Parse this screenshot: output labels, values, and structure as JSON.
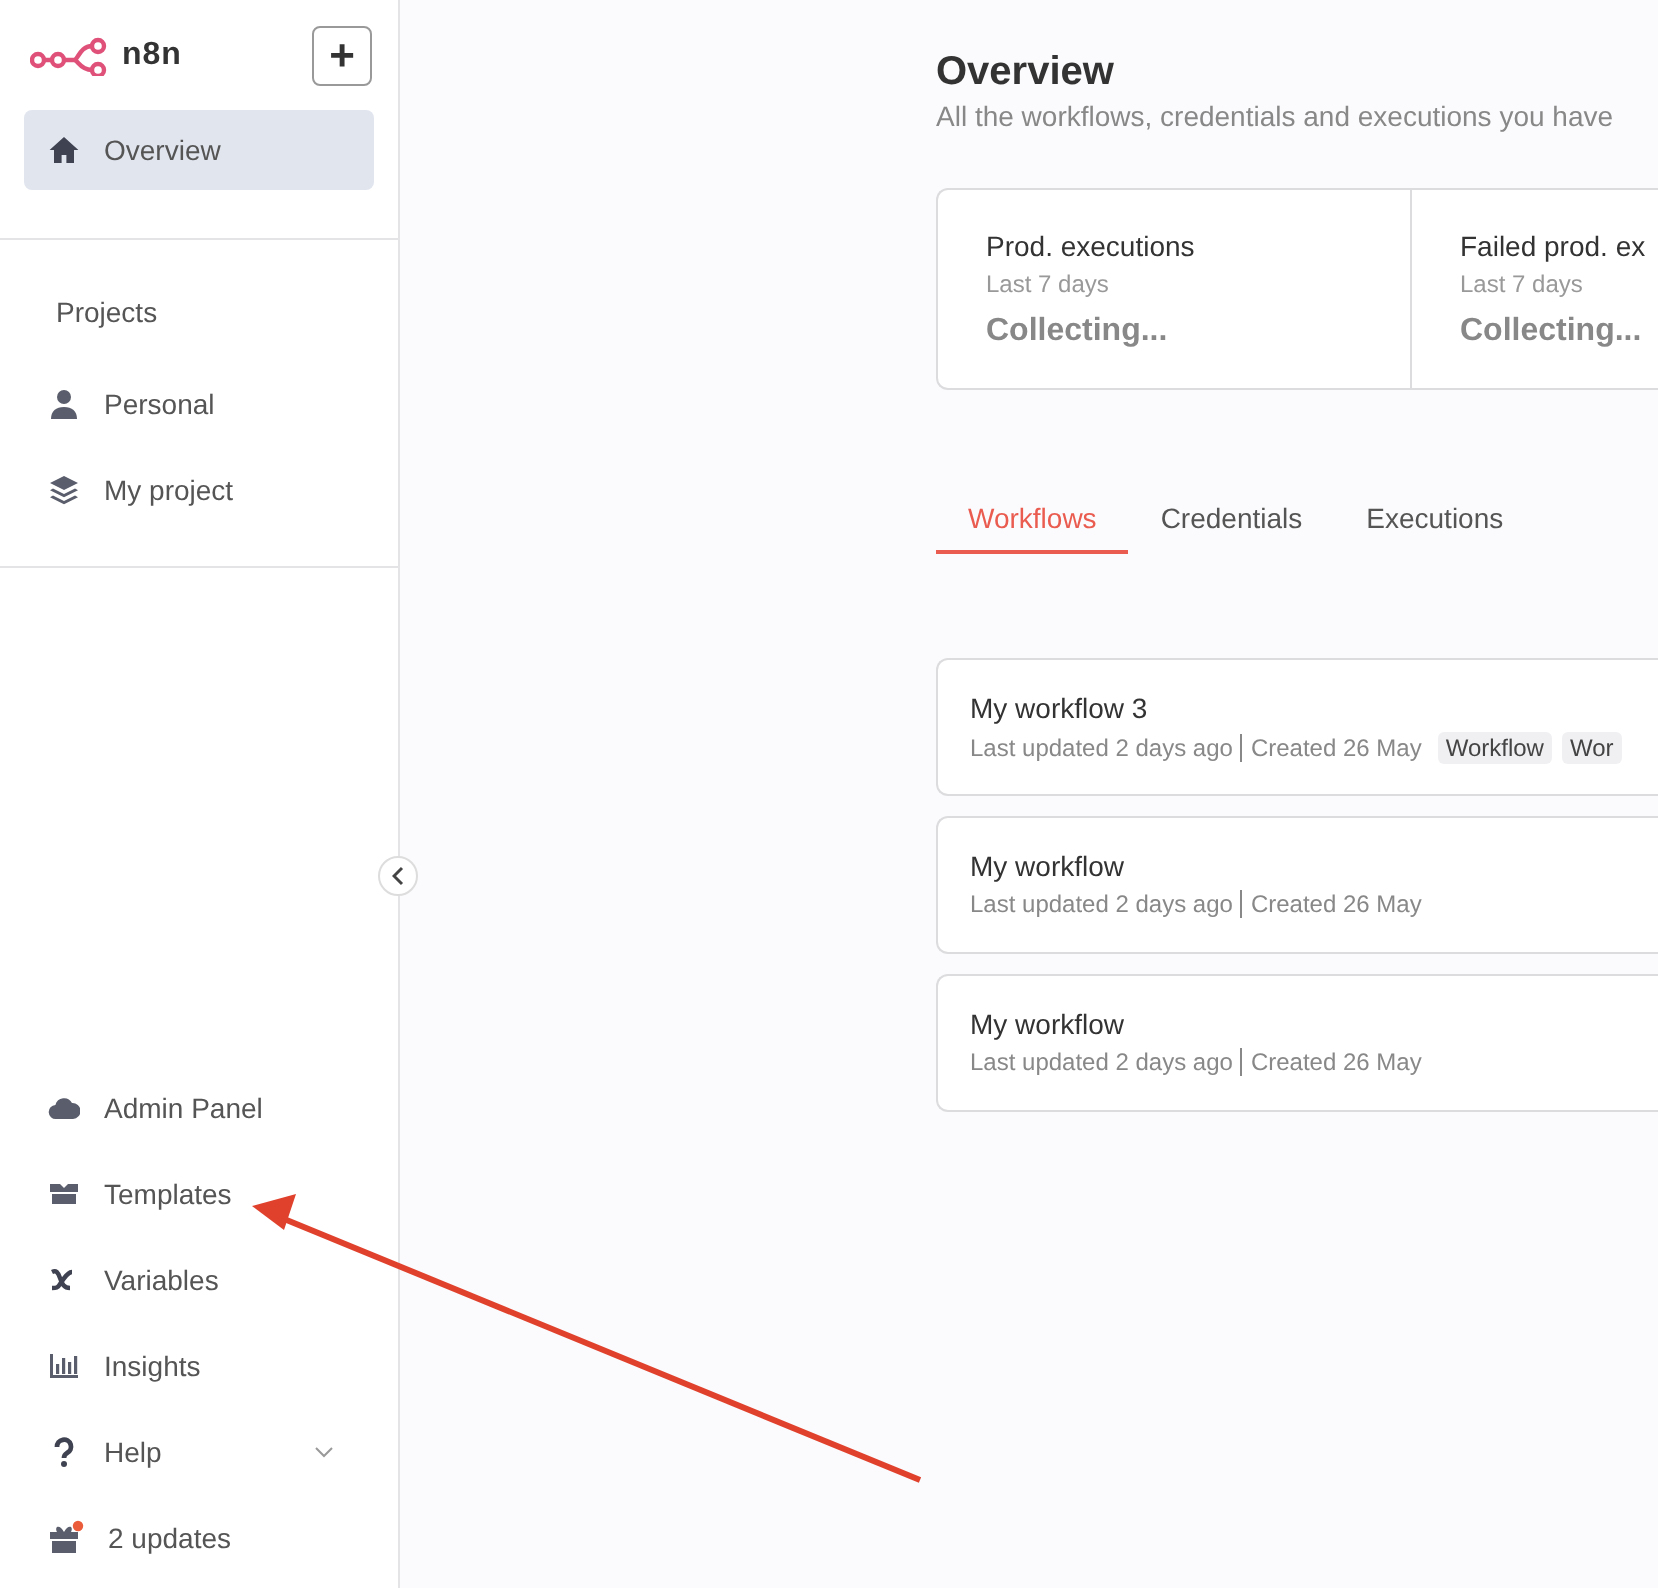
{
  "sidebar": {
    "logo_text": "n8n",
    "add_button": "+",
    "nav": [
      {
        "label": "Overview",
        "kind": "home",
        "selected": true
      }
    ],
    "projects_heading": "Projects",
    "projects": [
      {
        "label": "Personal",
        "kind": "user",
        "selected": false
      },
      {
        "label": "My project",
        "kind": "layers",
        "selected": false
      }
    ],
    "bottom": [
      {
        "label": "Admin Panel",
        "kind": "cloud"
      },
      {
        "label": "Templates",
        "kind": "box"
      },
      {
        "label": "Variables",
        "kind": "variable"
      },
      {
        "label": "Insights",
        "kind": "chart"
      },
      {
        "label": "Help",
        "kind": "help"
      },
      {
        "label": "2 updates",
        "kind": "gift"
      }
    ]
  },
  "main": {
    "title": "Overview",
    "subtitle": "All the workflows, credentials and executions you have",
    "stats": [
      {
        "title": "Prod. executions",
        "period": "Last 7 days",
        "value": "Collecting..."
      },
      {
        "title": "Failed prod. ex",
        "period": "Last 7 days",
        "value": "Collecting..."
      }
    ],
    "tabs": [
      {
        "label": "Workflows",
        "selected": true
      },
      {
        "label": "Credentials",
        "selected": false
      },
      {
        "label": "Executions",
        "selected": false
      }
    ],
    "workflows": [
      {
        "name": "My workflow 3",
        "updated": "Last updated 2 days ago",
        "created": "Created 26 May",
        "tags": [
          "Workflow",
          "Wor"
        ]
      },
      {
        "name": "My workflow",
        "updated": "Last updated 2 days ago",
        "created": "Created 26 May"
      },
      {
        "name": "My workflow",
        "updated": "Last updated 2 days ago",
        "created": "Created 26 May"
      }
    ]
  }
}
